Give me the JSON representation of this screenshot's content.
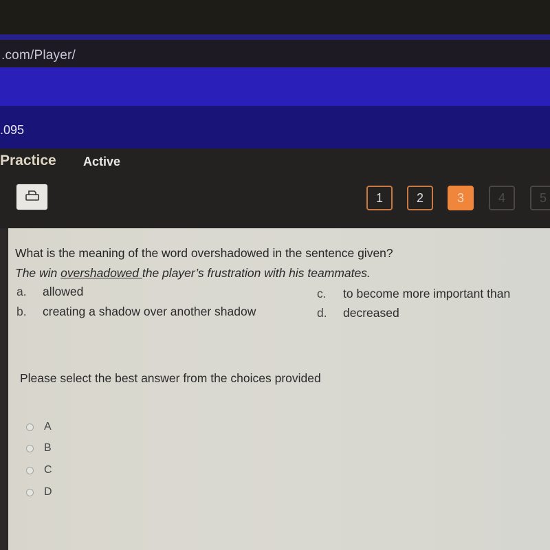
{
  "browser": {
    "url_fragment": ".com/Player/"
  },
  "header": {
    "course_code": ".095"
  },
  "activity_bar": {
    "tabs": [
      {
        "label": "Practice"
      },
      {
        "label": "Active"
      }
    ],
    "print_icon": "printer-icon",
    "question_nav": [
      {
        "label": "1",
        "state": "visited"
      },
      {
        "label": "2",
        "state": "visited"
      },
      {
        "label": "3",
        "state": "current"
      },
      {
        "label": "4",
        "state": "locked"
      },
      {
        "label": "5",
        "state": "locked"
      }
    ],
    "accent_color": "#f0853c"
  },
  "question": {
    "prompt": "What is the meaning of the word overshadowed in the sentence given?",
    "sentence_before": "The win ",
    "sentence_underlined": "overshadowed ",
    "sentence_after": "the player’s frustration with his teammates.",
    "choices": [
      {
        "letter": "a.",
        "text": "allowed"
      },
      {
        "letter": "b.",
        "text": "creating a shadow over another shadow"
      },
      {
        "letter": "c.",
        "text": "to become more important than"
      },
      {
        "letter": "d.",
        "text": "decreased"
      }
    ]
  },
  "answer": {
    "instructions": "Please select the best answer from the choices provided",
    "options": [
      {
        "label": "A",
        "selected": false
      },
      {
        "label": "B",
        "selected": false
      },
      {
        "label": "C",
        "selected": false
      },
      {
        "label": "D",
        "selected": false
      }
    ]
  }
}
